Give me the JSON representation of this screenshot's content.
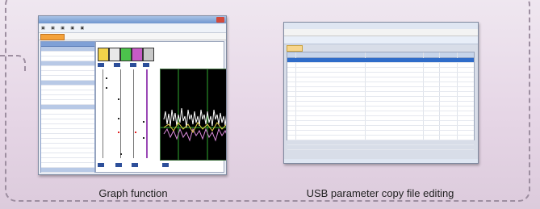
{
  "captions": {
    "left": "Graph function",
    "right": "USB parameter copy file editing"
  },
  "colors": {
    "frame": "#9d8ea0",
    "accent_tab": "#f4a23a",
    "highlight_box": "#d61a1a",
    "selected_row": "#2f6cc9"
  },
  "icons": [
    "window-close-icon",
    "ok-button"
  ]
}
